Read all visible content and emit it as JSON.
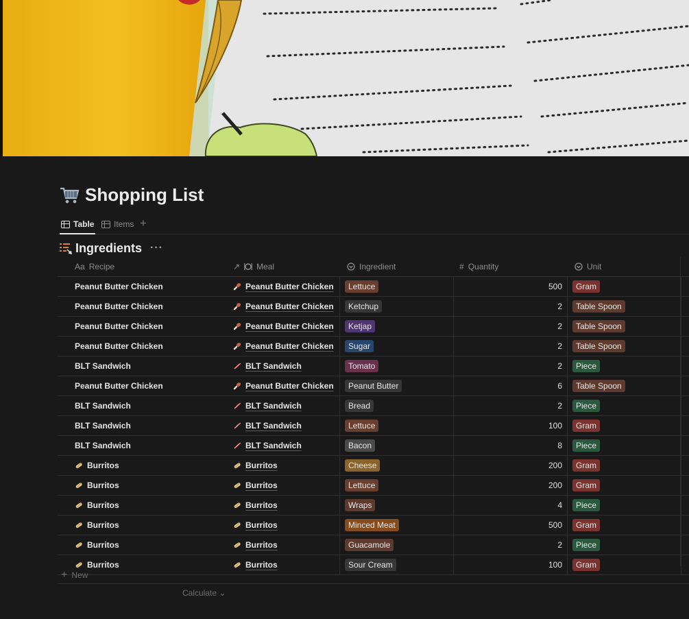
{
  "page": {
    "title": "Shopping List",
    "icon": "shopping-cart-icon"
  },
  "tabs": [
    {
      "label": "Table",
      "icon": "table-icon",
      "active": true
    },
    {
      "label": "Items",
      "icon": "table-icon",
      "active": false
    }
  ],
  "database": {
    "title": "Ingredients",
    "icon": "recipe-list-icon",
    "more": "···"
  },
  "columns": [
    {
      "label": "Recipe",
      "icon_text": "Aa"
    },
    {
      "label": "Meal",
      "icon": "relation-arrow-icon"
    },
    {
      "label": "Ingredient",
      "icon": "select-icon"
    },
    {
      "label": "Quantity",
      "icon_text": "#"
    },
    {
      "label": "Unit",
      "icon": "select-icon"
    }
  ],
  "rows": [
    {
      "recipe": "Peanut Butter Chicken",
      "recipe_icon": "",
      "meal": "Peanut Butter Chicken",
      "meal_icon": "drumstick-icon",
      "ingredient": "Lettuce",
      "ing_color": "#6a3e2e",
      "quantity": "500",
      "unit": "Gram",
      "unit_color": "#7a332e"
    },
    {
      "recipe": "Peanut Butter Chicken",
      "recipe_icon": "",
      "meal": "Peanut Butter Chicken",
      "meal_icon": "drumstick-icon",
      "ingredient": "Ketchup",
      "ing_color": "#373737",
      "quantity": "2",
      "unit": "Table Spoon",
      "unit_color": "#5e3a2e"
    },
    {
      "recipe": "Peanut Butter Chicken",
      "recipe_icon": "",
      "meal": "Peanut Butter Chicken",
      "meal_icon": "drumstick-icon",
      "ingredient": "Ketjap",
      "ing_color": "#4f3472",
      "quantity": "2",
      "unit": "Table Spoon",
      "unit_color": "#5e3a2e"
    },
    {
      "recipe": "Peanut Butter Chicken",
      "recipe_icon": "",
      "meal": "Peanut Butter Chicken",
      "meal_icon": "drumstick-icon",
      "ingredient": "Sugar",
      "ing_color": "#28456c",
      "quantity": "2",
      "unit": "Table Spoon",
      "unit_color": "#5e3a2e"
    },
    {
      "recipe": "BLT Sandwich",
      "recipe_icon": "",
      "meal": "BLT Sandwich",
      "meal_icon": "bacon-icon",
      "ingredient": "Tomato",
      "ing_color": "#69314c",
      "quantity": "2",
      "unit": "Piece",
      "unit_color": "#2b593f"
    },
    {
      "recipe": "Peanut Butter Chicken",
      "recipe_icon": "",
      "meal": "Peanut Butter Chicken",
      "meal_icon": "drumstick-icon",
      "ingredient": "Peanut Butter",
      "ing_color": "#373737",
      "quantity": "6",
      "unit": "Table Spoon",
      "unit_color": "#5e3a2e"
    },
    {
      "recipe": "BLT Sandwich",
      "recipe_icon": "",
      "meal": "BLT Sandwich",
      "meal_icon": "bacon-icon",
      "ingredient": "Bread",
      "ing_color": "#373737",
      "quantity": "2",
      "unit": "Piece",
      "unit_color": "#2b593f"
    },
    {
      "recipe": "BLT Sandwich",
      "recipe_icon": "",
      "meal": "BLT Sandwich",
      "meal_icon": "bacon-icon",
      "ingredient": "Lettuce",
      "ing_color": "#6a3e2e",
      "quantity": "100",
      "unit": "Gram",
      "unit_color": "#7a332e"
    },
    {
      "recipe": "BLT Sandwich",
      "recipe_icon": "",
      "meal": "BLT Sandwich",
      "meal_icon": "bacon-icon",
      "ingredient": "Bacon",
      "ing_color": "#4a4a4a",
      "quantity": "8",
      "unit": "Piece",
      "unit_color": "#2b593f"
    },
    {
      "recipe": "Burritos",
      "recipe_icon": "burrito-icon",
      "meal": "Burritos",
      "meal_icon": "burrito-icon",
      "ingredient": "Cheese",
      "ing_color": "#89632a",
      "quantity": "200",
      "unit": "Gram",
      "unit_color": "#7a332e"
    },
    {
      "recipe": "Burritos",
      "recipe_icon": "burrito-icon",
      "meal": "Burritos",
      "meal_icon": "burrito-icon",
      "ingredient": "Lettuce",
      "ing_color": "#6a3e2e",
      "quantity": "200",
      "unit": "Gram",
      "unit_color": "#7a332e"
    },
    {
      "recipe": "Burritos",
      "recipe_icon": "burrito-icon",
      "meal": "Burritos",
      "meal_icon": "burrito-icon",
      "ingredient": "Wraps",
      "ing_color": "#5e3a2e",
      "quantity": "4",
      "unit": "Piece",
      "unit_color": "#2b593f"
    },
    {
      "recipe": "Burritos",
      "recipe_icon": "burrito-icon",
      "meal": "Burritos",
      "meal_icon": "burrito-icon",
      "ingredient": "Minced Meat",
      "ing_color": "#854c1d",
      "quantity": "500",
      "unit": "Gram",
      "unit_color": "#7a332e"
    },
    {
      "recipe": "Burritos",
      "recipe_icon": "burrito-icon",
      "meal": "Burritos",
      "meal_icon": "burrito-icon",
      "ingredient": "Guacamole",
      "ing_color": "#5e3a2e",
      "quantity": "2",
      "unit": "Piece",
      "unit_color": "#2b593f"
    },
    {
      "recipe": "Burritos",
      "recipe_icon": "burrito-icon",
      "meal": "Burritos",
      "meal_icon": "burrito-icon",
      "ingredient": "Sour Cream",
      "ing_color": "#373737",
      "quantity": "100",
      "unit": "Gram",
      "unit_color": "#7a332e"
    }
  ],
  "footer": {
    "new_label": "New",
    "calculate_label": "Calculate"
  }
}
